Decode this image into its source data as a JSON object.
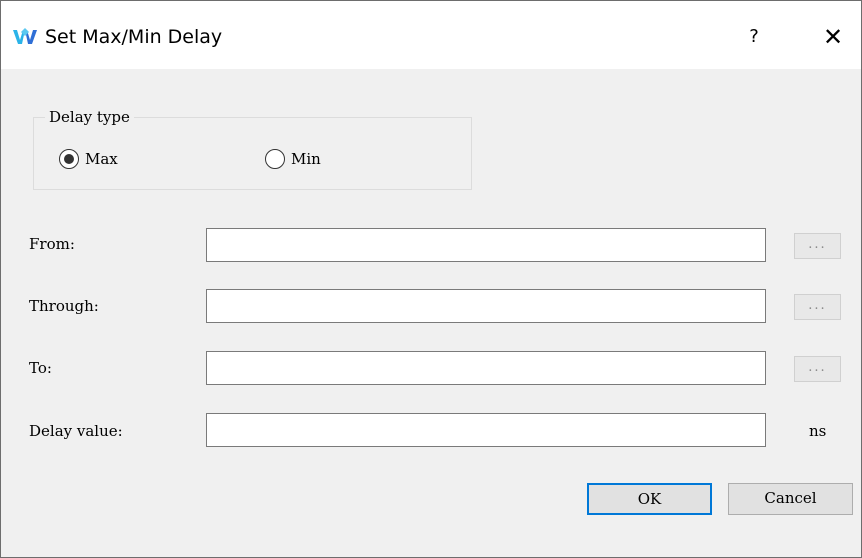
{
  "window": {
    "title": "Set Max/Min Delay",
    "help_label": "?",
    "close_label": "✕",
    "app_icon": "gowin-logo-icon"
  },
  "delay_type": {
    "group_title": "Delay type",
    "options": [
      {
        "label": "Max",
        "checked": true
      },
      {
        "label": "Min",
        "checked": false
      }
    ]
  },
  "fields": {
    "from": {
      "label": "From:",
      "value": "",
      "browse_label": "..."
    },
    "through": {
      "label": "Through:",
      "value": "",
      "browse_label": "..."
    },
    "to": {
      "label": "To:",
      "value": "",
      "browse_label": "..."
    },
    "delay_value": {
      "label": "Delay value:",
      "value": "",
      "unit": "ns"
    }
  },
  "buttons": {
    "ok_label": "OK",
    "cancel_label": "Cancel"
  },
  "colors": {
    "accent": "#0078d7",
    "logo_blue": "#2f6fd6",
    "logo_cyan": "#2bb3e8"
  }
}
